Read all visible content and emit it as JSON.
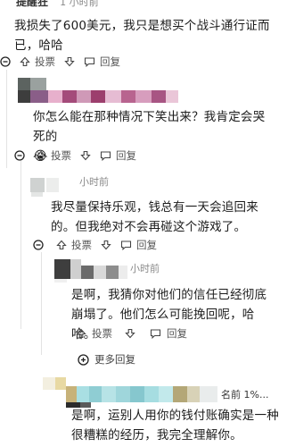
{
  "header": {
    "name": "提醒狂",
    "time": "1 小时前"
  },
  "comments": [
    {
      "text": "我损失了600美元，我只是想买个战斗通行证而已，哈哈",
      "vote_label": "投票",
      "reply_label": "回复"
    },
    {
      "text": "你怎么能在那种情况下笑出来？我肯定会哭死的",
      "emoji": "😭",
      "vote_label": "投票",
      "reply_label": "回复"
    },
    {
      "time": "小时前",
      "text": "我尽量保持乐观，钱总有一天会追回来的。但我绝对不会再碰这个游戏了。",
      "vote_label": "投票",
      "reply_label": "回复"
    },
    {
      "time": "小时前",
      "text": "是啊，我猜你对他们的信任已经彻底崩塌了。他们怎么可能挽回呢，哈哈。",
      "vote_label": "投票",
      "reply_label": "回复"
    },
    {
      "rank": "名前 1%...",
      "text": "是啊，运别人用你的钱付账确实是一种很糟糕的经历，我完全理解你。"
    }
  ],
  "more_replies": "更多回复",
  "colors": {
    "text": "#1c1c1c",
    "meta": "#8a8a8a",
    "thread_line": "#e2e2e2"
  }
}
